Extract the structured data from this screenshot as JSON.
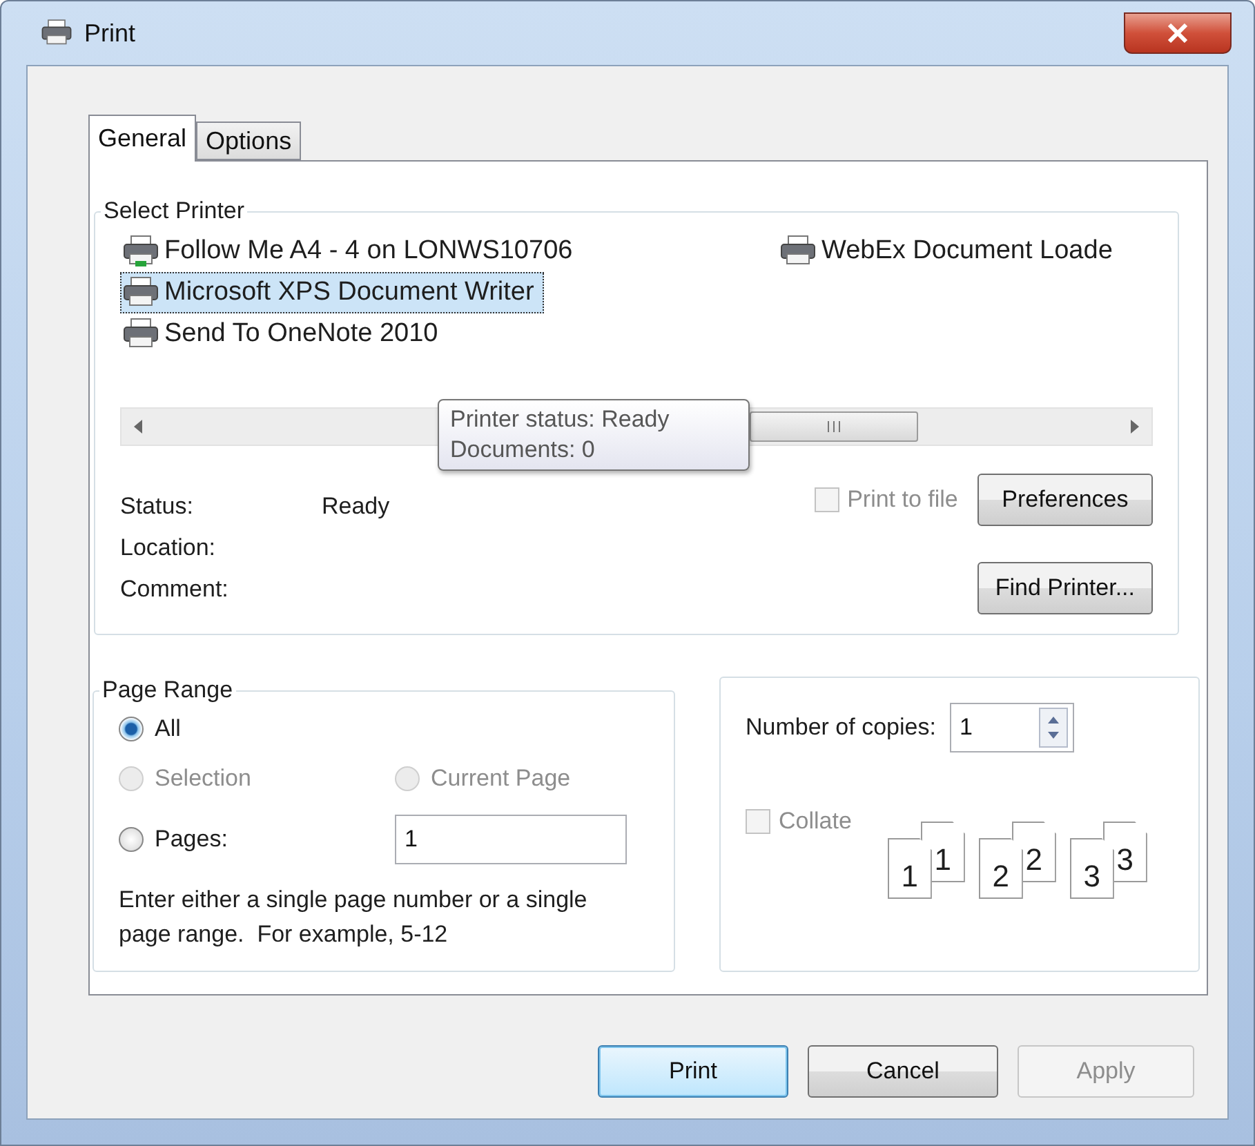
{
  "window": {
    "title": "Print"
  },
  "tabs": [
    {
      "label": "General",
      "selected": true
    },
    {
      "label": "Options",
      "selected": false
    }
  ],
  "select_printer": {
    "title": "Select Printer",
    "printers": [
      {
        "name": "Follow Me A4 - 4 on LONWS10706",
        "kind": "network",
        "selected": false
      },
      {
        "name": "Microsoft XPS Document Writer",
        "kind": "local",
        "selected": true
      },
      {
        "name": "Send To OneNote 2010",
        "kind": "local",
        "selected": false
      },
      {
        "name": "WebEx Document Loade",
        "kind": "local",
        "selected": false
      }
    ],
    "tooltip": [
      "Printer status: Ready",
      "Documents: 0"
    ],
    "info": [
      {
        "label": "Status:",
        "value": "Ready"
      },
      {
        "label": "Location:"
      },
      {
        "label": "Comment:"
      }
    ],
    "print_to_file": {
      "label": "Print to file",
      "checked": false,
      "disabled": true
    },
    "buttons": [
      "Preferences",
      "Find Printer..."
    ]
  },
  "page_range": {
    "title": "Page Range",
    "options": [
      {
        "label": "All",
        "selected": true,
        "disabled": false
      },
      {
        "label": "Selection",
        "selected": false,
        "disabled": true
      },
      {
        "label": "Current Page",
        "selected": false,
        "disabled": true
      },
      {
        "label": "Pages:",
        "selected": false,
        "disabled": false
      }
    ],
    "pages_value": "1",
    "hint": "Enter either a single page number or a single page range.  For example, 5-12"
  },
  "copies": {
    "label": "Number of copies:",
    "value": "1",
    "collate": {
      "label": "Collate",
      "checked": false,
      "disabled": true
    },
    "collate_sets": [
      {
        "back": "1",
        "front": "1"
      },
      {
        "back": "2",
        "front": "2"
      },
      {
        "back": "3",
        "front": "3"
      }
    ]
  },
  "buttons": [
    {
      "label": "Print",
      "default": true,
      "disabled": false
    },
    {
      "label": "Cancel",
      "default": false,
      "disabled": false
    },
    {
      "label": "Apply",
      "default": false,
      "disabled": true
    }
  ]
}
